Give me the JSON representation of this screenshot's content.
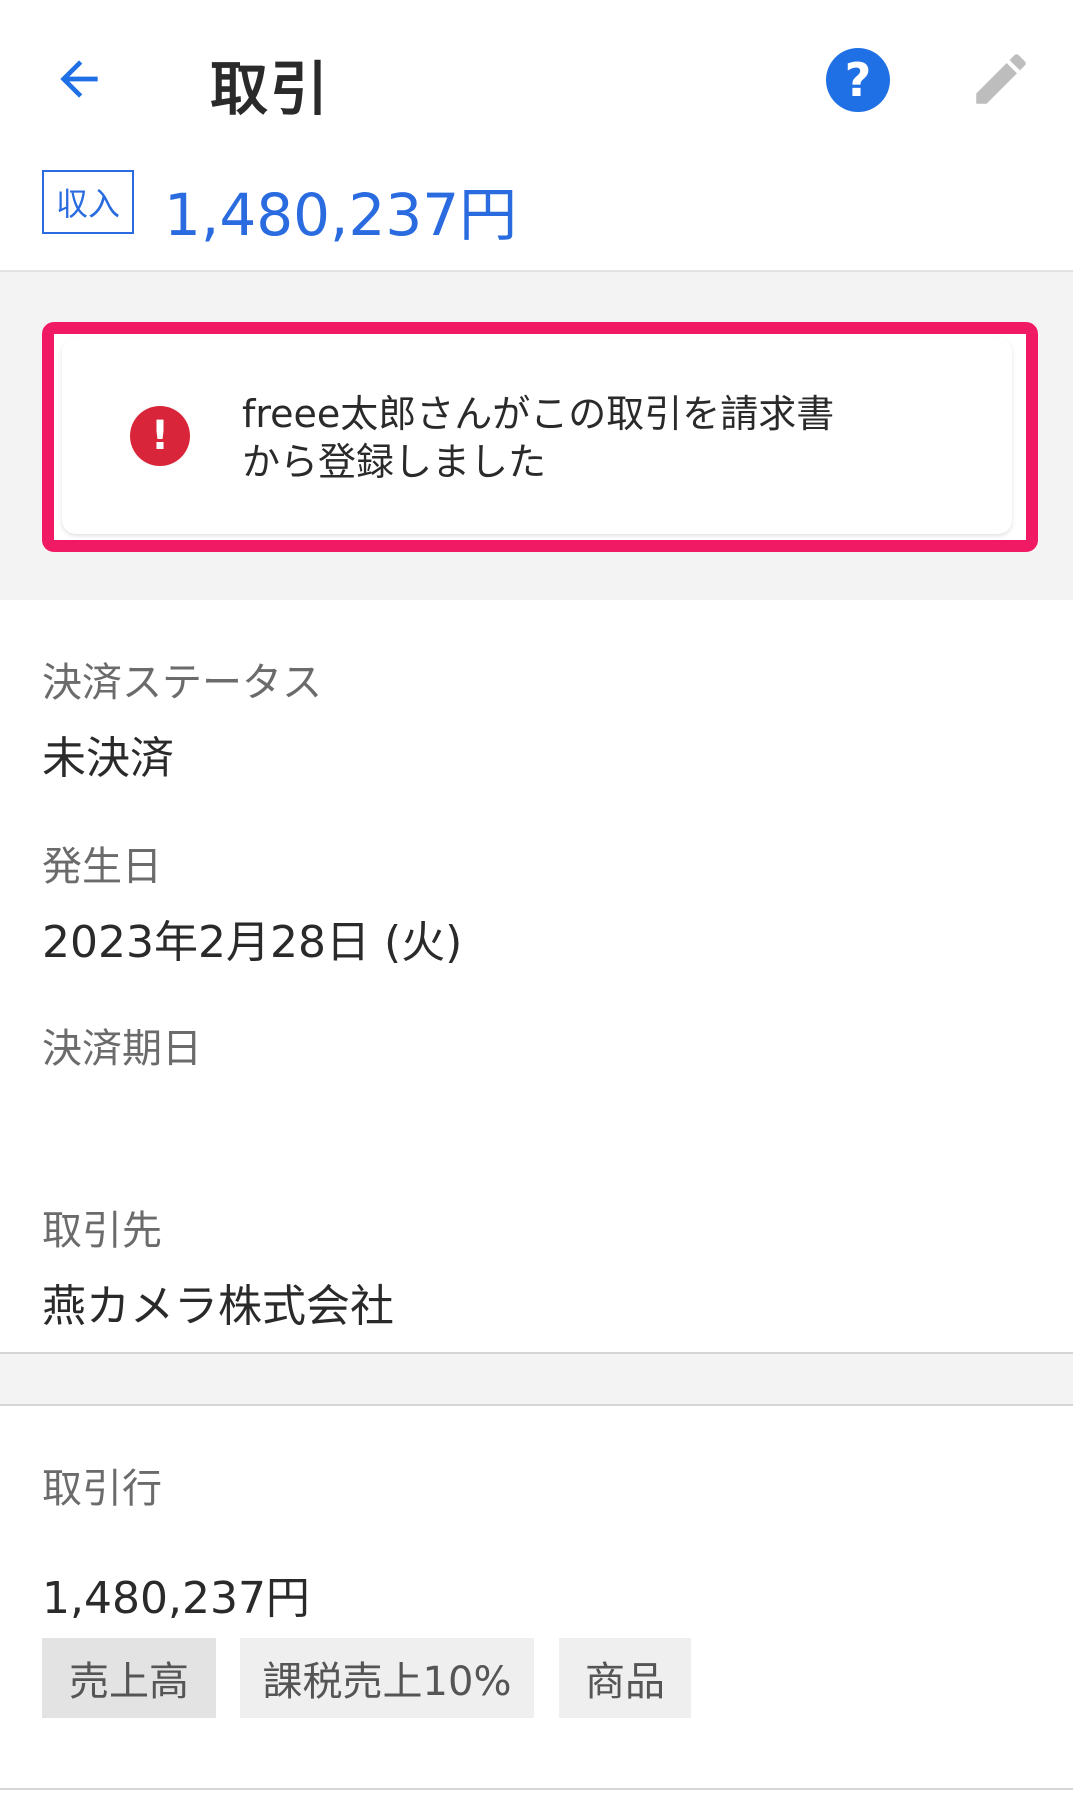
{
  "header": {
    "title": "取引",
    "back_icon": "arrow-left-icon",
    "help_icon": "help-icon",
    "help_glyph": "?",
    "edit_icon": "pencil-icon",
    "type_badge": "収入",
    "amount": "1,480,237円"
  },
  "notice": {
    "icon": "alert-icon",
    "icon_glyph": "!",
    "line1": "freee太郎さんがこの取引を請求書",
    "line2": "から登録しました"
  },
  "fields": {
    "payment_status_label": "決済ステータス",
    "payment_status_value": "未決済",
    "issue_date_label": "発生日",
    "issue_date_value": "2023年2月28日 (火)",
    "due_date_label": "決済期日",
    "partner_label": "取引先",
    "partner_value": "燕カメラ株式会社"
  },
  "lines": {
    "section_label": "取引行",
    "line_amount": "1,480,237円",
    "tags": [
      "売上高",
      "課税売上10%",
      "商品"
    ]
  },
  "colors": {
    "accent": "#1f6fe5",
    "highlight": "#f01a64",
    "alert": "#d8253a"
  }
}
